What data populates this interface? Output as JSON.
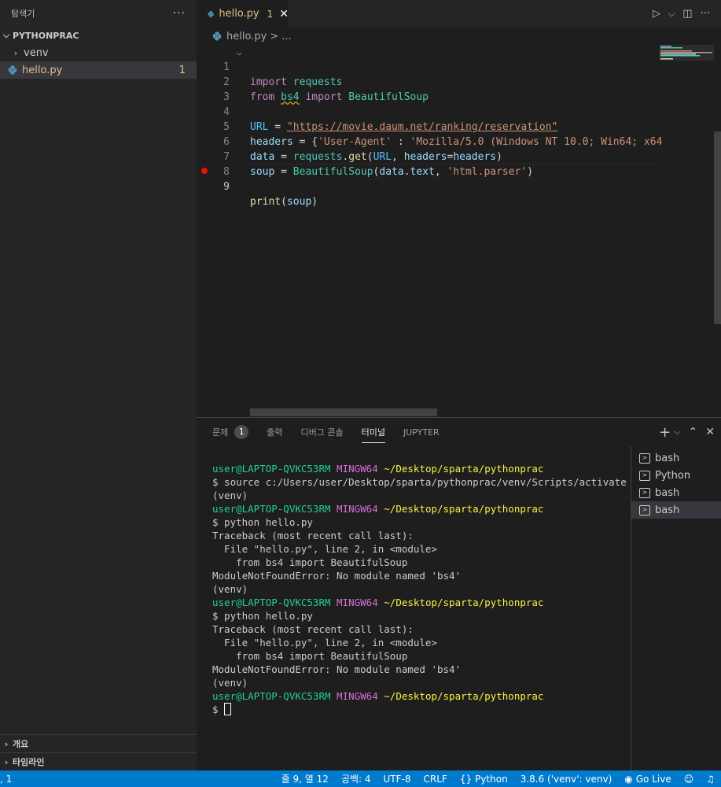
{
  "explorer": {
    "title": "탐색기",
    "more": "···",
    "project": "PYTHONPRAC",
    "items": [
      {
        "label": "venv"
      },
      {
        "label": "hello.py",
        "badge": "1"
      }
    ],
    "outline": "개요",
    "timeline": "타임라인"
  },
  "tab": {
    "label": "hello.py",
    "problems": "1",
    "close": "✕"
  },
  "breadcrumb": {
    "file": "hello.py",
    "rest": "> ..."
  },
  "editor": {
    "lines": [
      {
        "n": "1"
      },
      {
        "n": "2"
      },
      {
        "n": "3"
      },
      {
        "n": "4"
      },
      {
        "n": "5"
      },
      {
        "n": "6"
      },
      {
        "n": "7"
      },
      {
        "n": "8"
      },
      {
        "n": "9"
      }
    ],
    "code": {
      "l1_kw": "import",
      "l1_mod": "requests",
      "l2_kw1": "from",
      "l2_mod": "bs4",
      "l2_kw2": "import",
      "l2_cls": "BeautifulSoup",
      "l4_var": "URL",
      "l4_eq": " = ",
      "l4_str": "\"https://movie.daum.net/ranking/reservation\"",
      "l5_var": "headers",
      "l5_eq": " = {",
      "l5_s1": "'User-Agent'",
      "l5_col": " : ",
      "l5_s2": "'Mozilla/5.0 (Windows NT 10.0; Win64; x64",
      "l6_var": "data",
      "l6_eq": " = ",
      "l6_mod": "requests",
      "l6_dot": ".",
      "l6_fn": "get",
      "l6_p1": "(",
      "l6_a1": "URL",
      "l6_c": ", ",
      "l6_a2": "headers",
      "l6_e": "=",
      "l6_a3": "headers",
      "l6_p2": ")",
      "l7_var": "soup",
      "l7_eq": " = ",
      "l7_cls": "BeautifulSoup",
      "l7_p1": "(",
      "l7_a1": "data",
      "l7_dot": ".",
      "l7_a2": "text",
      "l7_c": ", ",
      "l7_str": "'html.parser'",
      "l7_p2": ")",
      "l9_fn": "print",
      "l9_p1": "(",
      "l9_a": "soup",
      "l9_p2": ")"
    }
  },
  "panel": {
    "tabs": [
      {
        "label": "문제",
        "badge": "1"
      },
      {
        "label": "출력"
      },
      {
        "label": "디버그 콘솔"
      },
      {
        "label": "터미널"
      },
      {
        "label": "JUPYTER"
      }
    ],
    "actions": {
      "add": "+",
      "dropdown": "⌵",
      "split": "⌃",
      "close": "✕"
    },
    "terminals": [
      "bash",
      "Python",
      "bash",
      "bash"
    ]
  },
  "terminal": {
    "user": "user@LAPTOP-QVKC53RM",
    "host": "MINGW64",
    "path": "~/Desktop/sparta/pythonprac",
    "cmd_source": "$ source c:/Users/user/Desktop/sparta/pythonprac/venv/Scripts/activate",
    "venv": "(venv)",
    "cmd_python": "$ python hello.py",
    "tb1": "Traceback (most recent call last):",
    "tb2": "  File \"hello.py\", line 2, in <module>",
    "tb3": "    from bs4 import BeautifulSoup",
    "tb4": "ModuleNotFoundError: No module named 'bs4'",
    "prompt": "$ "
  },
  "status": {
    "left": ", 1",
    "position": "줄 9, 열 12",
    "spaces": "공백: 4",
    "encoding": "UTF-8",
    "eol": "CRLF",
    "language": "Python",
    "interpreter": "3.8.6 ('venv': venv)",
    "golive": "Go Live"
  }
}
